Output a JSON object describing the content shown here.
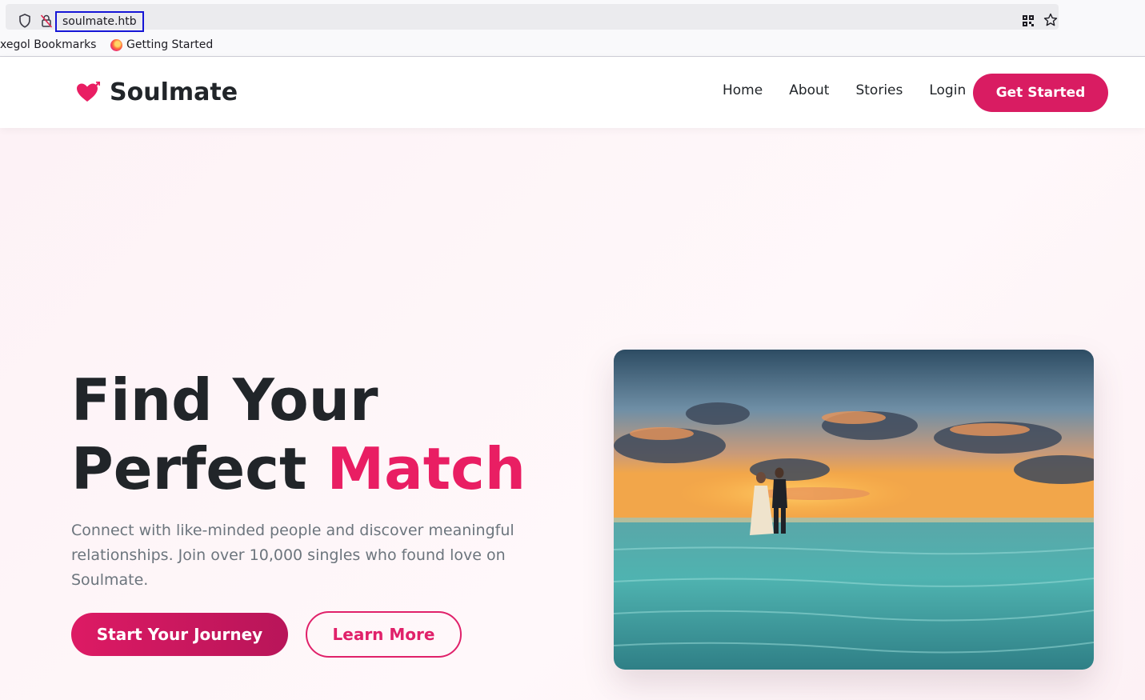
{
  "browser": {
    "url": "soulmate.htb",
    "bookmarks": [
      "xegol Bookmarks",
      "Getting Started"
    ]
  },
  "site": {
    "brand": "Soulmate",
    "nav": [
      "Home",
      "About",
      "Stories",
      "Login"
    ],
    "cta": "Get Started"
  },
  "hero": {
    "title_line1": "Find Your",
    "title_line2_prefix": "Perfect",
    "title_accent": "Match",
    "subtitle": "Connect with like-minded people and discover meaningful relationships. Join over 10,000 singles who found love on Soulmate.",
    "primary_button": "Start Your Journey",
    "secondary_button": "Learn More"
  },
  "colors": {
    "brand_pink": "#e91e63",
    "button_pink": "#d91c62",
    "text_dark": "#212529",
    "text_muted": "#6c757d"
  }
}
